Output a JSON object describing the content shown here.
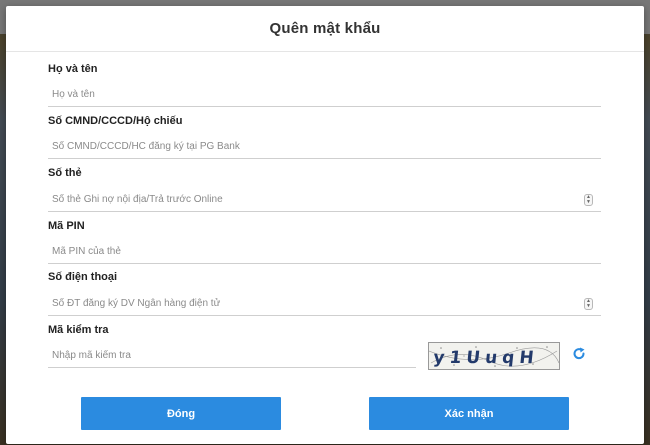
{
  "modal": {
    "title": "Quên mật khẩu"
  },
  "form": {
    "full_name": {
      "label": "Họ và tên",
      "placeholder": "Họ và tên",
      "value": ""
    },
    "id_number": {
      "label": "Số CMND/CCCD/Hộ chiếu",
      "placeholder": "Số CMND/CCCD/HC đăng ký tại PG Bank",
      "value": ""
    },
    "card_number": {
      "label": "Số thẻ",
      "placeholder": "Số thẻ Ghi nợ nội địa/Trả trước Online",
      "value": ""
    },
    "pin": {
      "label": "Mã PIN",
      "placeholder": "Mã PIN của thẻ",
      "value": ""
    },
    "phone": {
      "label": "Số điện thoại",
      "placeholder": "Số ĐT đăng ký DV Ngân hàng điện tử",
      "value": ""
    },
    "captcha": {
      "label": "Mã kiểm tra",
      "placeholder": "Nhập mã kiểm tra",
      "value": "",
      "image_text": "y1UuqH"
    }
  },
  "buttons": {
    "close_label": "Đóng",
    "confirm_label": "Xác nhận"
  },
  "icons": {
    "spinner": "number-spinner-icon",
    "refresh": "refresh-captcha-icon"
  },
  "colors": {
    "primary_button": "#2b8be0",
    "refresh_icon": "#2b8be0"
  }
}
